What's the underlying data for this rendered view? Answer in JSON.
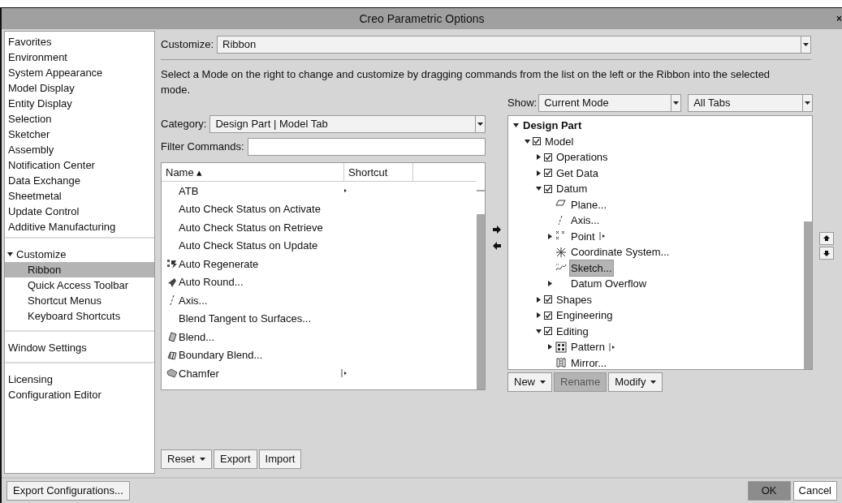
{
  "window": {
    "title": "Creo Parametric Options",
    "close": "×"
  },
  "sidebar": {
    "groups": [
      [
        {
          "label": "Favorites",
          "selected": false
        },
        {
          "label": "Environment",
          "selected": false
        },
        {
          "label": "System Appearance",
          "selected": false
        },
        {
          "label": "Model Display",
          "selected": false
        },
        {
          "label": "Entity Display",
          "selected": false
        },
        {
          "label": "Selection",
          "selected": false
        },
        {
          "label": "Sketcher",
          "selected": false
        },
        {
          "label": "Assembly",
          "selected": false
        },
        {
          "label": "Notification Center",
          "selected": false
        },
        {
          "label": "Data Exchange",
          "selected": false
        },
        {
          "label": "Sheetmetal",
          "selected": false
        },
        {
          "label": "Update Control",
          "selected": false
        },
        {
          "label": "Additive Manufacturing",
          "selected": false
        }
      ],
      [
        {
          "label": "Customize",
          "selected": false,
          "expanded": true,
          "children": [
            {
              "label": "Ribbon",
              "selected": true
            },
            {
              "label": "Quick Access Toolbar",
              "selected": false
            },
            {
              "label": "Shortcut Menus",
              "selected": false
            },
            {
              "label": "Keyboard Shortcuts",
              "selected": false
            }
          ]
        }
      ],
      [
        {
          "label": "Window Settings",
          "selected": false
        }
      ],
      [
        {
          "label": "Licensing",
          "selected": false
        },
        {
          "label": "Configuration Editor",
          "selected": false
        }
      ]
    ]
  },
  "customize": {
    "label": "Customize:",
    "value": "Ribbon"
  },
  "description": "Select a Mode on the right to change and customize by dragging commands from the list on the left or the Ribbon into the selected mode.",
  "category": {
    "label": "Category:",
    "value": "Design Part | Model Tab"
  },
  "filter": {
    "label": "Filter Commands:"
  },
  "commands": {
    "columns": [
      "Name ▴",
      "Shortcut"
    ],
    "rows": [
      {
        "name": "ATB",
        "kind": "none",
        "submenu": true,
        "split": false
      },
      {
        "name": "Auto Check Status on Activate",
        "kind": "none"
      },
      {
        "name": "Auto Check Status on Retrieve",
        "kind": "none"
      },
      {
        "name": "Auto Check Status on Update",
        "kind": "none"
      },
      {
        "name": "Auto Regenerate",
        "kind": "regen"
      },
      {
        "name": "Auto Round...",
        "kind": "round"
      },
      {
        "name": "Axis...",
        "kind": "axis"
      },
      {
        "name": "Blend Tangent to Surfaces...",
        "kind": "none"
      },
      {
        "name": "Blend...",
        "kind": "blend"
      },
      {
        "name": "Boundary Blend...",
        "kind": "boundary"
      },
      {
        "name": "Chamfer",
        "kind": "chamfer",
        "submenu": true,
        "split": true
      }
    ]
  },
  "show": {
    "label": "Show:",
    "mode": "Current Mode",
    "tabs": "All Tabs"
  },
  "tree": [
    {
      "label": "Design Part",
      "expanded": true,
      "bold": true,
      "children": [
        {
          "label": "Model",
          "expanded": true,
          "checked": true,
          "children": [
            {
              "label": "Operations",
              "expanded": false,
              "checked": true
            },
            {
              "label": "Get Data",
              "expanded": false,
              "checked": true
            },
            {
              "label": "Datum",
              "expanded": true,
              "checked": true,
              "children": [
                {
                  "label": "Plane...",
                  "kind": "plane",
                  "selected": false
                },
                {
                  "label": "Axis...",
                  "kind": "axis",
                  "selected": false
                },
                {
                  "label": "Point",
                  "kind": "point",
                  "expanded": false,
                  "submenu": true,
                  "selected": false
                },
                {
                  "label": "Coordinate System...",
                  "kind": "csys",
                  "selected": false
                },
                {
                  "label": "Sketch...",
                  "kind": "sketch",
                  "selected": true
                },
                {
                  "label": "Datum Overflow",
                  "kind": "blank",
                  "expanded": false,
                  "selected": false
                }
              ]
            },
            {
              "label": "Shapes",
              "expanded": false,
              "checked": true
            },
            {
              "label": "Engineering",
              "expanded": false,
              "checked": true
            },
            {
              "label": "Editing",
              "expanded": true,
              "checked": true,
              "children": [
                {
                  "label": "Pattern",
                  "kind": "pattern",
                  "expanded": false,
                  "submenu": true,
                  "selected": false
                },
                {
                  "label": "Mirror...",
                  "kind": "mirror",
                  "selected": false
                }
              ]
            }
          ]
        }
      ]
    }
  ],
  "tree_buttons": [
    {
      "label": "New",
      "dropdown": true,
      "disabled": false
    },
    {
      "label": "Rename",
      "dropdown": false,
      "disabled": true
    },
    {
      "label": "Modify",
      "dropdown": true,
      "disabled": false
    }
  ],
  "list_buttons": [
    {
      "label": "Reset",
      "dropdown": true
    },
    {
      "label": "Export",
      "dropdown": false
    },
    {
      "label": "Import",
      "dropdown": false
    }
  ],
  "footer": {
    "export": "Export Configurations...",
    "ok": "OK",
    "cancel": "Cancel"
  }
}
